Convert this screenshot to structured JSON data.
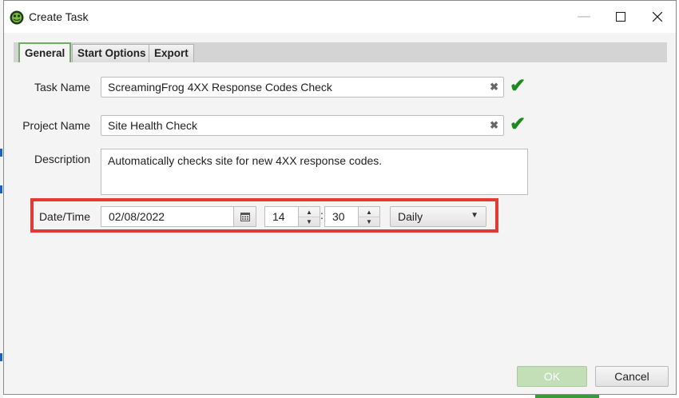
{
  "window": {
    "title": "Create Task"
  },
  "tabs": [
    {
      "label": "General",
      "active": true
    },
    {
      "label": "Start Options",
      "active": false
    },
    {
      "label": "Export",
      "active": false
    }
  ],
  "form": {
    "task_name": {
      "label": "Task Name",
      "value": "ScreamingFrog 4XX Response Codes Check",
      "valid": true
    },
    "project_name": {
      "label": "Project Name",
      "value": "Site Health Check",
      "valid": true
    },
    "description": {
      "label": "Description",
      "value": "Automatically checks site for new 4XX response codes."
    },
    "datetime": {
      "label": "Date/Time",
      "date": "02/08/2022",
      "hour": "14",
      "minute": "30",
      "separator": ":",
      "frequency": "Daily"
    }
  },
  "buttons": {
    "ok": "OK",
    "cancel": "Cancel"
  },
  "icons": {
    "app": "frog-icon",
    "clear": "clear-x-icon",
    "valid": "check-icon",
    "calendar": "calendar-icon",
    "spin_up": "spin-up-icon",
    "spin_down": "spin-down-icon",
    "dropdown": "chevron-down-icon"
  },
  "colors": {
    "highlight": "#e23b36",
    "check": "#1d8a1d",
    "active_tab_border": "#6fae62",
    "ok_button_disabled": "#c2dfb8"
  }
}
